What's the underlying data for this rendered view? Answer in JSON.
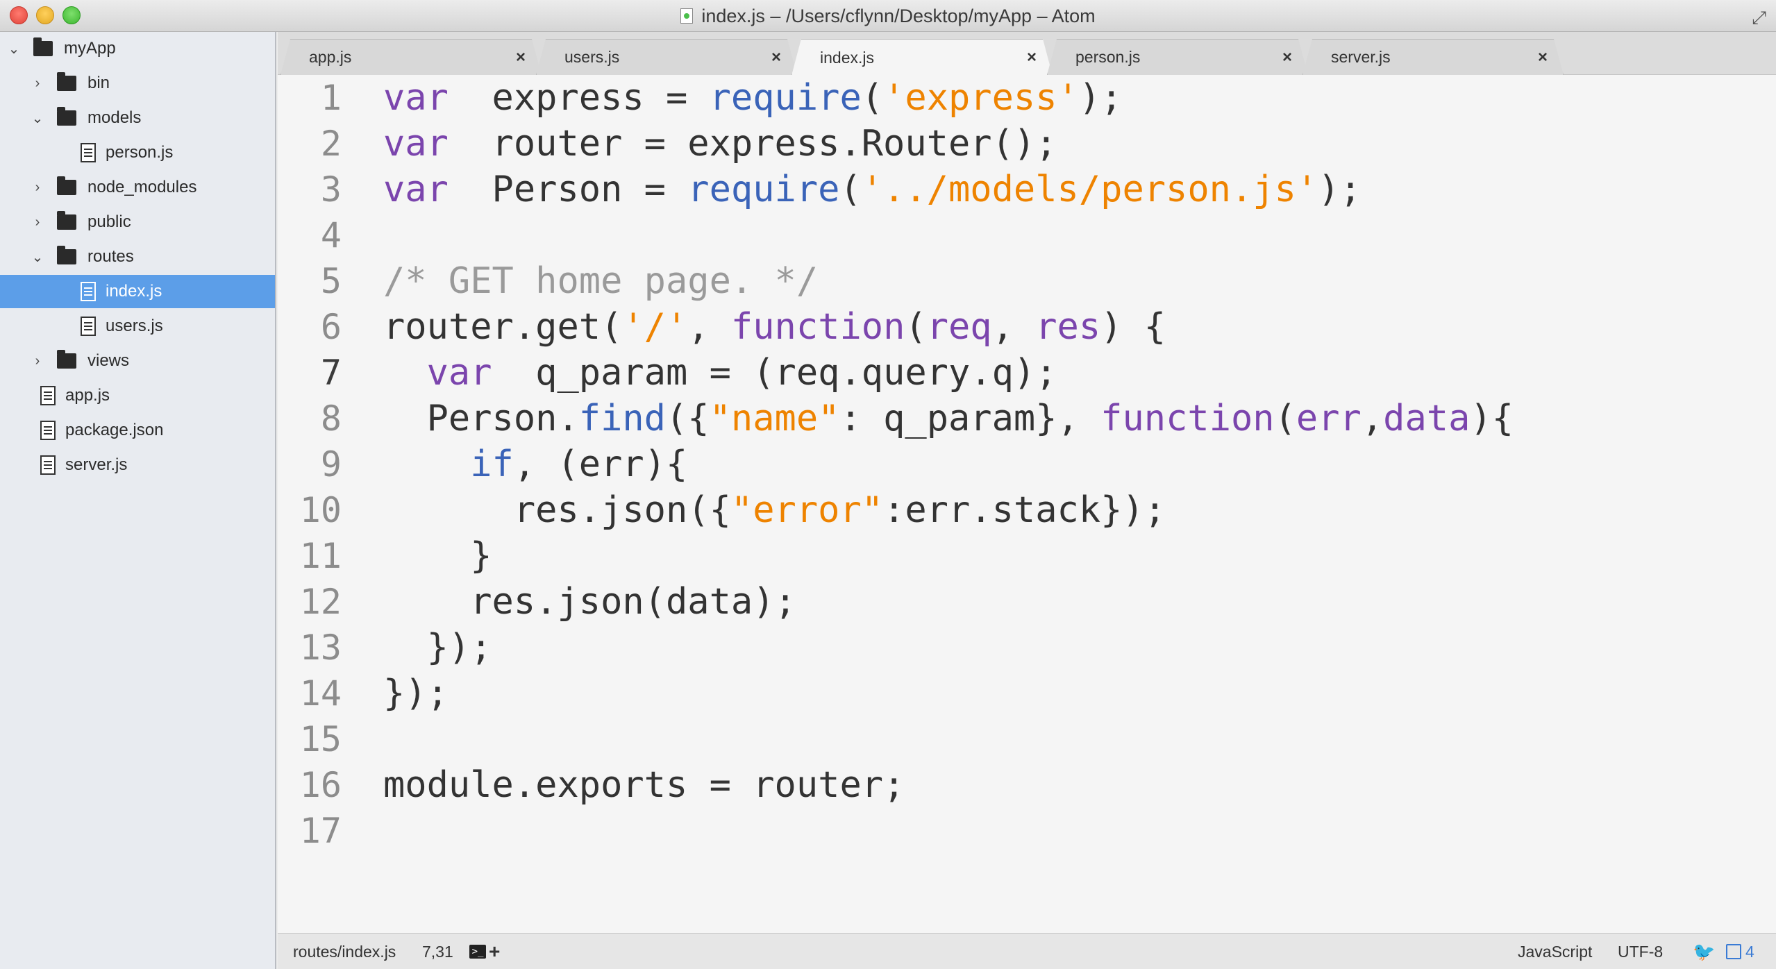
{
  "window": {
    "title": "index.js – /Users/cflynn/Desktop/myApp – Atom"
  },
  "tree": [
    {
      "label": "myApp",
      "type": "folder",
      "depth": 0,
      "expanded": true
    },
    {
      "label": "bin",
      "type": "folder",
      "depth": 1,
      "expanded": false
    },
    {
      "label": "models",
      "type": "folder",
      "depth": 1,
      "expanded": true
    },
    {
      "label": "person.js",
      "type": "file",
      "depth": 2
    },
    {
      "label": "node_modules",
      "type": "folder",
      "depth": 1,
      "expanded": false
    },
    {
      "label": "public",
      "type": "folder",
      "depth": 1,
      "expanded": false
    },
    {
      "label": "routes",
      "type": "folder",
      "depth": 1,
      "expanded": true
    },
    {
      "label": "index.js",
      "type": "file",
      "depth": 2,
      "selected": true
    },
    {
      "label": "users.js",
      "type": "file",
      "depth": 2
    },
    {
      "label": "views",
      "type": "folder",
      "depth": 1,
      "expanded": false
    },
    {
      "label": "app.js",
      "type": "file",
      "depth": 1
    },
    {
      "label": "package.json",
      "type": "file",
      "depth": 1
    },
    {
      "label": "server.js",
      "type": "file",
      "depth": 1
    }
  ],
  "tabs": [
    {
      "label": "app.js",
      "active": false
    },
    {
      "label": "users.js",
      "active": false
    },
    {
      "label": "index.js",
      "active": true
    },
    {
      "label": "person.js",
      "active": false
    },
    {
      "label": "server.js",
      "active": false
    }
  ],
  "tab_close_glyph": "×",
  "editor": {
    "current_line": 7,
    "lines": [
      [
        [
          "kw",
          "var"
        ],
        [
          "",
          "  express = "
        ],
        [
          "fn",
          "require"
        ],
        [
          "",
          "("
        ],
        [
          "str",
          "'express'"
        ],
        [
          "",
          ");"
        ]
      ],
      [
        [
          "kw",
          "var"
        ],
        [
          "",
          "  router = express.Router();"
        ]
      ],
      [
        [
          "kw",
          "var"
        ],
        [
          "",
          "  Person = "
        ],
        [
          "fn",
          "require"
        ],
        [
          "",
          "("
        ],
        [
          "str",
          "'../models/person.js'"
        ],
        [
          "",
          ");"
        ]
      ],
      [],
      [
        [
          "cmt",
          "/* GET home page. */"
        ]
      ],
      [
        [
          "",
          "router.get("
        ],
        [
          "str",
          "'/'"
        ],
        [
          "",
          ", "
        ],
        [
          "kw",
          "function"
        ],
        [
          "",
          "("
        ],
        [
          "kw",
          "req"
        ],
        [
          "",
          ", "
        ],
        [
          "kw",
          "res"
        ],
        [
          "",
          ") {"
        ]
      ],
      [
        [
          "",
          "  "
        ],
        [
          "kw",
          "var"
        ],
        [
          "",
          "  q_param = (req.query.q);"
        ]
      ],
      [
        [
          "",
          "  Person."
        ],
        [
          "fn",
          "find"
        ],
        [
          "",
          "({"
        ],
        [
          "str",
          "\"name\""
        ],
        [
          "",
          ": q_param}, "
        ],
        [
          "kw",
          "function"
        ],
        [
          "",
          "("
        ],
        [
          "kw",
          "err"
        ],
        [
          "",
          ","
        ],
        [
          "kw",
          "data"
        ],
        [
          "",
          "){"
        ]
      ],
      [
        [
          "",
          "    "
        ],
        [
          "fn",
          "if"
        ],
        [
          "",
          ", (err){"
        ]
      ],
      [
        [
          "",
          "      res.json({"
        ],
        [
          "str",
          "\"error\""
        ],
        [
          "",
          ":err.stack});"
        ]
      ],
      [
        [
          "",
          "    }"
        ]
      ],
      [
        [
          "",
          "    res.json(data);"
        ]
      ],
      [
        [
          "",
          "  });"
        ]
      ],
      [
        [
          "",
          "});"
        ]
      ],
      [],
      [
        [
          "",
          "module.exports = router;"
        ]
      ],
      []
    ]
  },
  "status": {
    "file_path": "routes/index.js",
    "cursor": "7,31",
    "grammar": "JavaScript",
    "encoding": "UTF-8",
    "package_count": "4"
  }
}
